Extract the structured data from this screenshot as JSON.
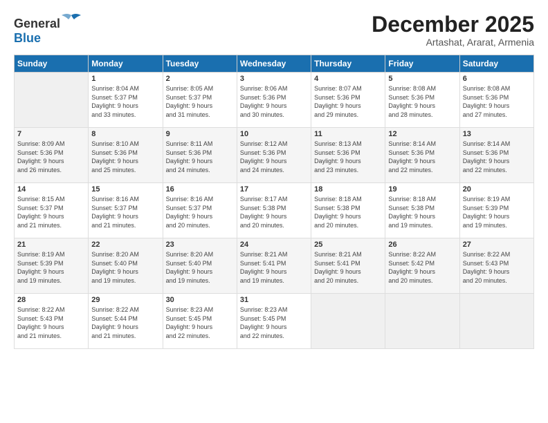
{
  "logo": {
    "text_general": "General",
    "text_blue": "Blue"
  },
  "title": {
    "month": "December 2025",
    "location": "Artashat, Ararat, Armenia"
  },
  "weekdays": [
    "Sunday",
    "Monday",
    "Tuesday",
    "Wednesday",
    "Thursday",
    "Friday",
    "Saturday"
  ],
  "weeks": [
    [
      {
        "day": "",
        "info": ""
      },
      {
        "day": "1",
        "info": "Sunrise: 8:04 AM\nSunset: 5:37 PM\nDaylight: 9 hours\nand 33 minutes."
      },
      {
        "day": "2",
        "info": "Sunrise: 8:05 AM\nSunset: 5:37 PM\nDaylight: 9 hours\nand 31 minutes."
      },
      {
        "day": "3",
        "info": "Sunrise: 8:06 AM\nSunset: 5:36 PM\nDaylight: 9 hours\nand 30 minutes."
      },
      {
        "day": "4",
        "info": "Sunrise: 8:07 AM\nSunset: 5:36 PM\nDaylight: 9 hours\nand 29 minutes."
      },
      {
        "day": "5",
        "info": "Sunrise: 8:08 AM\nSunset: 5:36 PM\nDaylight: 9 hours\nand 28 minutes."
      },
      {
        "day": "6",
        "info": "Sunrise: 8:08 AM\nSunset: 5:36 PM\nDaylight: 9 hours\nand 27 minutes."
      }
    ],
    [
      {
        "day": "7",
        "info": "Sunrise: 8:09 AM\nSunset: 5:36 PM\nDaylight: 9 hours\nand 26 minutes."
      },
      {
        "day": "8",
        "info": "Sunrise: 8:10 AM\nSunset: 5:36 PM\nDaylight: 9 hours\nand 25 minutes."
      },
      {
        "day": "9",
        "info": "Sunrise: 8:11 AM\nSunset: 5:36 PM\nDaylight: 9 hours\nand 24 minutes."
      },
      {
        "day": "10",
        "info": "Sunrise: 8:12 AM\nSunset: 5:36 PM\nDaylight: 9 hours\nand 24 minutes."
      },
      {
        "day": "11",
        "info": "Sunrise: 8:13 AM\nSunset: 5:36 PM\nDaylight: 9 hours\nand 23 minutes."
      },
      {
        "day": "12",
        "info": "Sunrise: 8:14 AM\nSunset: 5:36 PM\nDaylight: 9 hours\nand 22 minutes."
      },
      {
        "day": "13",
        "info": "Sunrise: 8:14 AM\nSunset: 5:36 PM\nDaylight: 9 hours\nand 22 minutes."
      }
    ],
    [
      {
        "day": "14",
        "info": "Sunrise: 8:15 AM\nSunset: 5:37 PM\nDaylight: 9 hours\nand 21 minutes."
      },
      {
        "day": "15",
        "info": "Sunrise: 8:16 AM\nSunset: 5:37 PM\nDaylight: 9 hours\nand 21 minutes."
      },
      {
        "day": "16",
        "info": "Sunrise: 8:16 AM\nSunset: 5:37 PM\nDaylight: 9 hours\nand 20 minutes."
      },
      {
        "day": "17",
        "info": "Sunrise: 8:17 AM\nSunset: 5:38 PM\nDaylight: 9 hours\nand 20 minutes."
      },
      {
        "day": "18",
        "info": "Sunrise: 8:18 AM\nSunset: 5:38 PM\nDaylight: 9 hours\nand 20 minutes."
      },
      {
        "day": "19",
        "info": "Sunrise: 8:18 AM\nSunset: 5:38 PM\nDaylight: 9 hours\nand 19 minutes."
      },
      {
        "day": "20",
        "info": "Sunrise: 8:19 AM\nSunset: 5:39 PM\nDaylight: 9 hours\nand 19 minutes."
      }
    ],
    [
      {
        "day": "21",
        "info": "Sunrise: 8:19 AM\nSunset: 5:39 PM\nDaylight: 9 hours\nand 19 minutes."
      },
      {
        "day": "22",
        "info": "Sunrise: 8:20 AM\nSunset: 5:40 PM\nDaylight: 9 hours\nand 19 minutes."
      },
      {
        "day": "23",
        "info": "Sunrise: 8:20 AM\nSunset: 5:40 PM\nDaylight: 9 hours\nand 19 minutes."
      },
      {
        "day": "24",
        "info": "Sunrise: 8:21 AM\nSunset: 5:41 PM\nDaylight: 9 hours\nand 19 minutes."
      },
      {
        "day": "25",
        "info": "Sunrise: 8:21 AM\nSunset: 5:41 PM\nDaylight: 9 hours\nand 20 minutes."
      },
      {
        "day": "26",
        "info": "Sunrise: 8:22 AM\nSunset: 5:42 PM\nDaylight: 9 hours\nand 20 minutes."
      },
      {
        "day": "27",
        "info": "Sunrise: 8:22 AM\nSunset: 5:43 PM\nDaylight: 9 hours\nand 20 minutes."
      }
    ],
    [
      {
        "day": "28",
        "info": "Sunrise: 8:22 AM\nSunset: 5:43 PM\nDaylight: 9 hours\nand 21 minutes."
      },
      {
        "day": "29",
        "info": "Sunrise: 8:22 AM\nSunset: 5:44 PM\nDaylight: 9 hours\nand 21 minutes."
      },
      {
        "day": "30",
        "info": "Sunrise: 8:23 AM\nSunset: 5:45 PM\nDaylight: 9 hours\nand 22 minutes."
      },
      {
        "day": "31",
        "info": "Sunrise: 8:23 AM\nSunset: 5:45 PM\nDaylight: 9 hours\nand 22 minutes."
      },
      {
        "day": "",
        "info": ""
      },
      {
        "day": "",
        "info": ""
      },
      {
        "day": "",
        "info": ""
      }
    ]
  ]
}
